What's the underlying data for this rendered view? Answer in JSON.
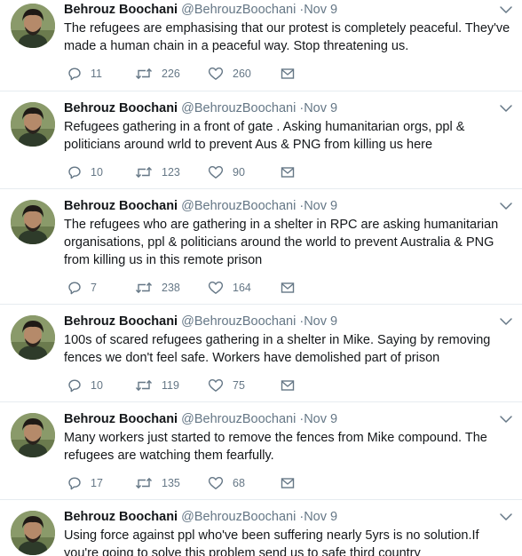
{
  "tweets": [
    {
      "name": "Behrouz Boochani",
      "handle": "@BehrouzBoochani",
      "separator": "·",
      "date": "Nov 9",
      "text": "The refugees are emphasising that our protest is completely peaceful. They've made a human chain in a peaceful way. Stop threatening us.",
      "replies": "11",
      "retweets": "226",
      "likes": "260"
    },
    {
      "name": "Behrouz Boochani",
      "handle": "@BehrouzBoochani",
      "separator": "·",
      "date": "Nov 9",
      "text": "Refugees gathering in a front of gate . Asking humanitarian orgs, ppl & politicians around wrld to prevent Aus & PNG from killing us here",
      "replies": "10",
      "retweets": "123",
      "likes": "90"
    },
    {
      "name": "Behrouz Boochani",
      "handle": "@BehrouzBoochani",
      "separator": "·",
      "date": "Nov 9",
      "text": "The refugees who are gathering in a shelter in RPC are asking humanitarian organisations, ppl & politicians around the world to prevent Australia & PNG from killing us in this remote prison",
      "replies": "7",
      "retweets": "238",
      "likes": "164"
    },
    {
      "name": "Behrouz Boochani",
      "handle": "@BehrouzBoochani",
      "separator": "·",
      "date": "Nov 9",
      "text": "100s of scared refugees gathering in a shelter in Mike. Saying by removing fences we don't feel safe. Workers have demolished part of prison",
      "replies": "10",
      "retweets": "119",
      "likes": "75"
    },
    {
      "name": "Behrouz Boochani",
      "handle": "@BehrouzBoochani",
      "separator": "·",
      "date": "Nov 9",
      "text": "Many workers just started to remove the fences from Mike compound. The refugees are watching them fearfully.",
      "replies": "17",
      "retweets": "135",
      "likes": "68"
    },
    {
      "name": "Behrouz Boochani",
      "handle": "@BehrouzBoochani",
      "separator": "·",
      "date": "Nov 9",
      "text": "Using force against ppl who've been suffering nearly 5yrs is no solution.If you're going to solve this problem send us to safe third country",
      "replies": "",
      "retweets": "",
      "likes": ""
    }
  ],
  "icons": {
    "reply": "reply-icon",
    "retweet": "retweet-icon",
    "like": "heart-icon",
    "message": "message-icon",
    "caret": "chevron-down-icon"
  },
  "colors": {
    "text": "#14171a",
    "secondary": "#657786",
    "divider": "#e6ecf0"
  }
}
